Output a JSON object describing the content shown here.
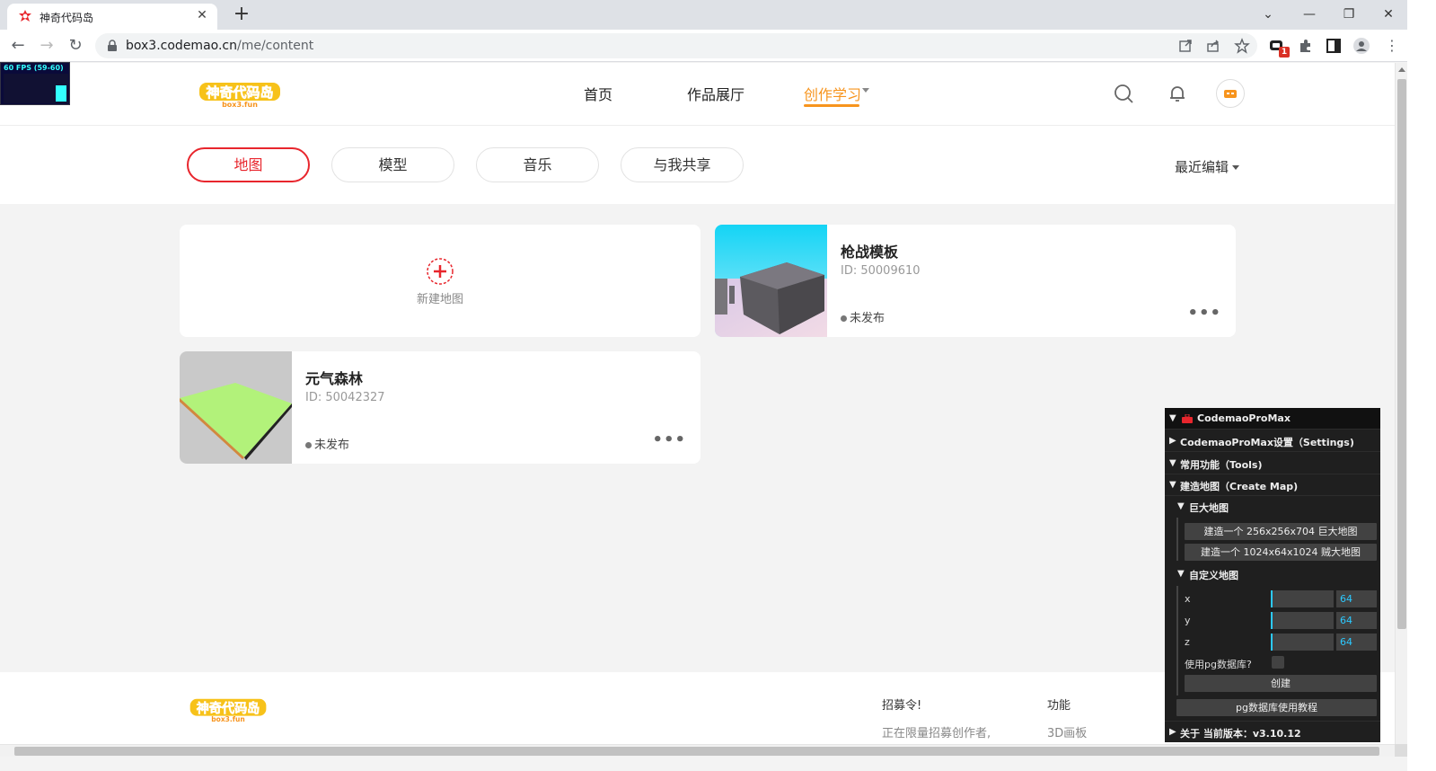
{
  "browser": {
    "tab_title": "神奇代码岛",
    "url_host": "box3.codemao.cn",
    "url_path": "/me/content",
    "extension_badge": "1"
  },
  "fps": {
    "label": "60 FPS (59-60)"
  },
  "header": {
    "nav": [
      {
        "label": "首页"
      },
      {
        "label": "作品展厅"
      },
      {
        "label": "创作学习"
      }
    ]
  },
  "filters": {
    "pills": [
      {
        "label": "地图"
      },
      {
        "label": "模型"
      },
      {
        "label": "音乐"
      },
      {
        "label": "与我共享"
      }
    ],
    "sort_label": "最近编辑"
  },
  "cards": {
    "new_label": "新建地图",
    "items": [
      {
        "title": "枪战模板",
        "id": "ID: 50009610",
        "status": "未发布"
      },
      {
        "title": "元气森林",
        "id": "ID: 50042327",
        "status": "未发布"
      }
    ]
  },
  "footer": {
    "col1_title": "招募令!",
    "col1_text": "正在限量招募创作者,",
    "col2_title": "功能",
    "col2_text": "3D画板"
  },
  "gui": {
    "title": "CodemaoProMax",
    "settings_folder": "CodemaoProMax设置（Settings)",
    "tools_folder": "常用功能（Tools)",
    "create_map_folder": "建造地图（Create Map)",
    "huge_map_folder": "巨大地图",
    "btn_huge1": "建造一个 256x256x704 巨大地图",
    "btn_huge2": "建造一个 1024x64x1024 贼大地图",
    "custom_folder": "自定义地图",
    "fields": [
      {
        "label": "x",
        "value": "64"
      },
      {
        "label": "y",
        "value": "64"
      },
      {
        "label": "z",
        "value": "64"
      }
    ],
    "use_pg_label": "使用pg数据库?",
    "create_btn": "创建",
    "pg_tutorial_btn": "pg数据库使用教程",
    "about_folder": "关于 当前版本：v3.10.12"
  }
}
